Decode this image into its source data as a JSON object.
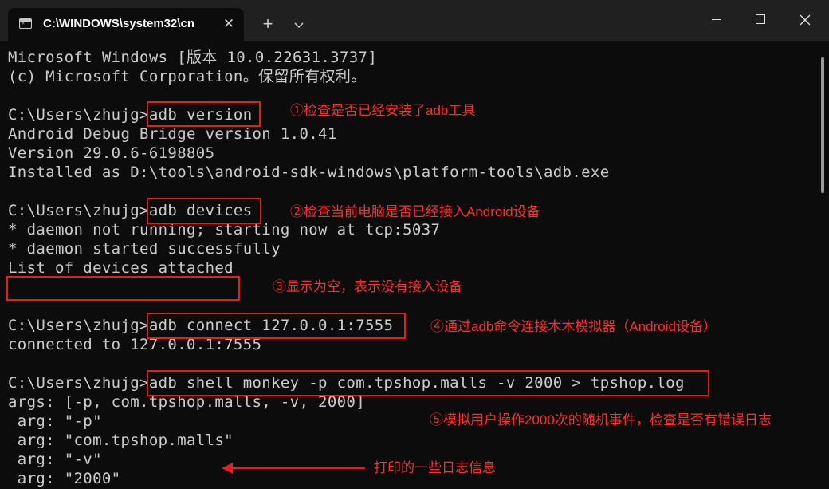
{
  "window": {
    "tab_title": "C:\\WINDOWS\\system32\\cn",
    "tab_close": "✕",
    "new_tab": "+"
  },
  "console": {
    "lines": [
      "Microsoft Windows [版本 10.0.22631.3737]",
      "(c) Microsoft Corporation。保留所有权利。",
      "C:\\Users\\zhujg>adb version",
      "Android Debug Bridge version 1.0.41",
      "Version 29.0.6-6198805",
      "Installed as D:\\tools\\android-sdk-windows\\platform-tools\\adb.exe",
      "C:\\Users\\zhujg>adb devices",
      "* daemon not running; starting now at tcp:5037",
      "* daemon started successfully",
      "List of devices attached",
      "C:\\Users\\zhujg>adb connect 127.0.0.1:7555",
      "connected to 127.0.0.1:7555",
      "C:\\Users\\zhujg>adb shell monkey -p com.tpshop.malls -v 2000 > tpshop.log",
      "args: [-p, com.tpshop.malls, -v, 2000]",
      " arg: \"-p\"",
      " arg: \"com.tpshop.malls\"",
      " arg: \"-v\"",
      " arg: \"2000\""
    ]
  },
  "annotations": {
    "note1": "①检查是否已经安装了adb工具",
    "note2": "②检查当前电脑是否已经接入Android设备",
    "note3": "③显示为空，表示没有接入设备",
    "note4": "④通过adb命令连接木木模拟器（Android设备）",
    "note5": "⑤模拟用户操作2000次的随机事件，检查是否有错误日志",
    "note6": "打印的一些日志信息"
  },
  "colors": {
    "console_bg": "#0c0c0c",
    "console_text": "#cccccc",
    "annotation_red": "#e02020",
    "titlebar_bg": "#202020"
  }
}
